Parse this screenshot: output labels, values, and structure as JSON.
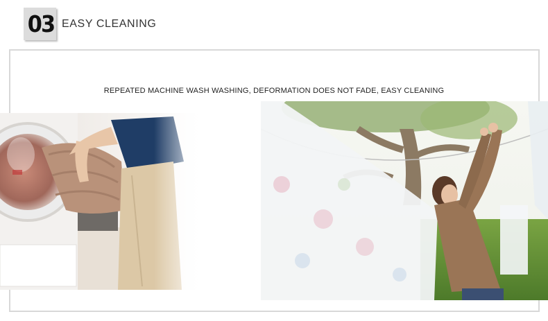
{
  "section": {
    "number": "03",
    "title": "EASY CLEANING"
  },
  "caption": "REPEATED MACHINE WASH WASHING, DEFORMATION DOES NOT FADE, EASY CLEANING",
  "colors": {
    "badge_bg": "#dcdcdc",
    "frame_border": "#d8d8d8",
    "text": "#333333"
  }
}
